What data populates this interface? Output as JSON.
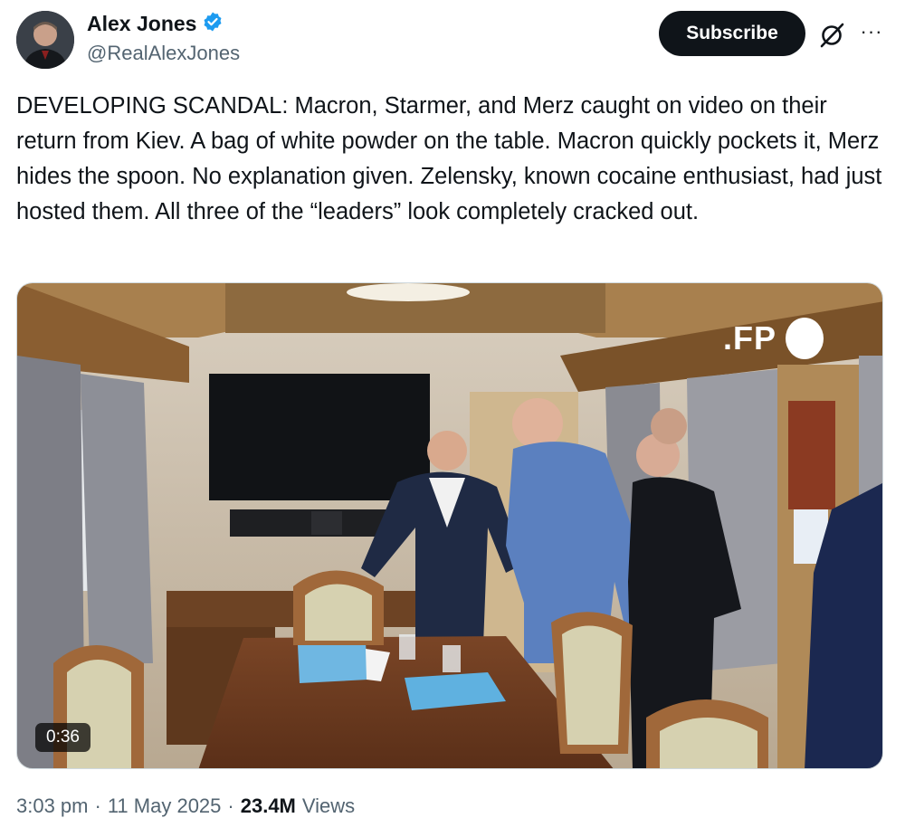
{
  "author": {
    "name": "Alex Jones",
    "handle": "@RealAlexJones",
    "verified": true,
    "verified_color": "#1d9bf0"
  },
  "header": {
    "subscribe_label": "Subscribe",
    "grok_icon": "grok-icon",
    "more_icon": "more-icon",
    "more_label": "···"
  },
  "tweet": {
    "text": "DEVELOPING SCANDAL: Macron, Starmer, and Merz caught on video on their return from Kiev. A bag of white powder on the table. Macron quickly pockets it, Merz hides the spoon. No explanation given. Zelensky, known cocaine enthusiast, had just hosted them. All three of the “leaders” look completely cracked out."
  },
  "media": {
    "duration": "0:36",
    "watermark": ".FP"
  },
  "meta": {
    "time": "3:03 pm",
    "sep1": "·",
    "date": "11 May 2025",
    "sep2": "·",
    "views_count": "23.4M",
    "views_label": "Views"
  },
  "colors": {
    "text": "#0f1419",
    "secondary": "#536471",
    "button_bg": "#0f1419",
    "border": "#cfd9de"
  }
}
